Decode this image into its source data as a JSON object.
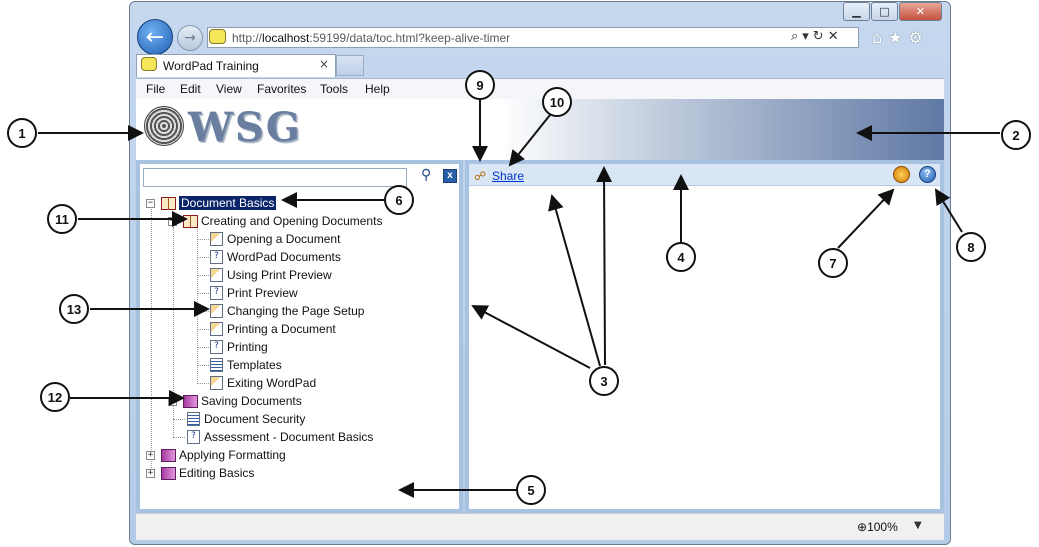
{
  "browser": {
    "url_prefix": "http://",
    "url_host": "localhost",
    "url_rest": ":59199/data/toc.html?keep-alive-timer",
    "tab_title": "WordPad Training",
    "tab_close": "×",
    "menu": [
      "File",
      "Edit",
      "View",
      "Favorites",
      "Tools",
      "Help"
    ],
    "caption_buttons": {
      "minimize": "▁",
      "maximize": "□",
      "close": "✕"
    },
    "nav": {
      "back": "←",
      "forward": "→"
    },
    "address_tools": "⌕▾↻✕",
    "toolbar_icons": "⌂★⚙",
    "zoom_label": "100%",
    "zoom_arrow": "▼"
  },
  "header": {
    "logo_text": "WSG"
  },
  "toolbar": {
    "share_label": "Share",
    "help_label": "?"
  },
  "search": {
    "placeholder": "",
    "search_icon": "⚲",
    "clear_icon": "x"
  },
  "tree": {
    "root": "Document Basics",
    "creating": "Creating and Opening Documents",
    "topics": [
      "Opening a Document",
      "WordPad Documents",
      "Using Print Preview",
      "Print Preview",
      "Changing the Page Setup",
      "Printing a Document",
      "Printing",
      "Templates",
      "Exiting WordPad"
    ],
    "saving": "Saving Documents",
    "security": "Document Security",
    "assessment": "Assessment - Document Basics",
    "applying": "Applying Formatting",
    "editing": "Editing Basics",
    "expander_plus": "+",
    "expander_minus": "−"
  },
  "callouts": [
    "1",
    "2",
    "3",
    "4",
    "5",
    "6",
    "7",
    "8",
    "9",
    "10",
    "11",
    "12",
    "13"
  ],
  "colors": {
    "accent": "#0a246a",
    "pane_border": "#a8c2e2",
    "link": "#0033cc"
  }
}
